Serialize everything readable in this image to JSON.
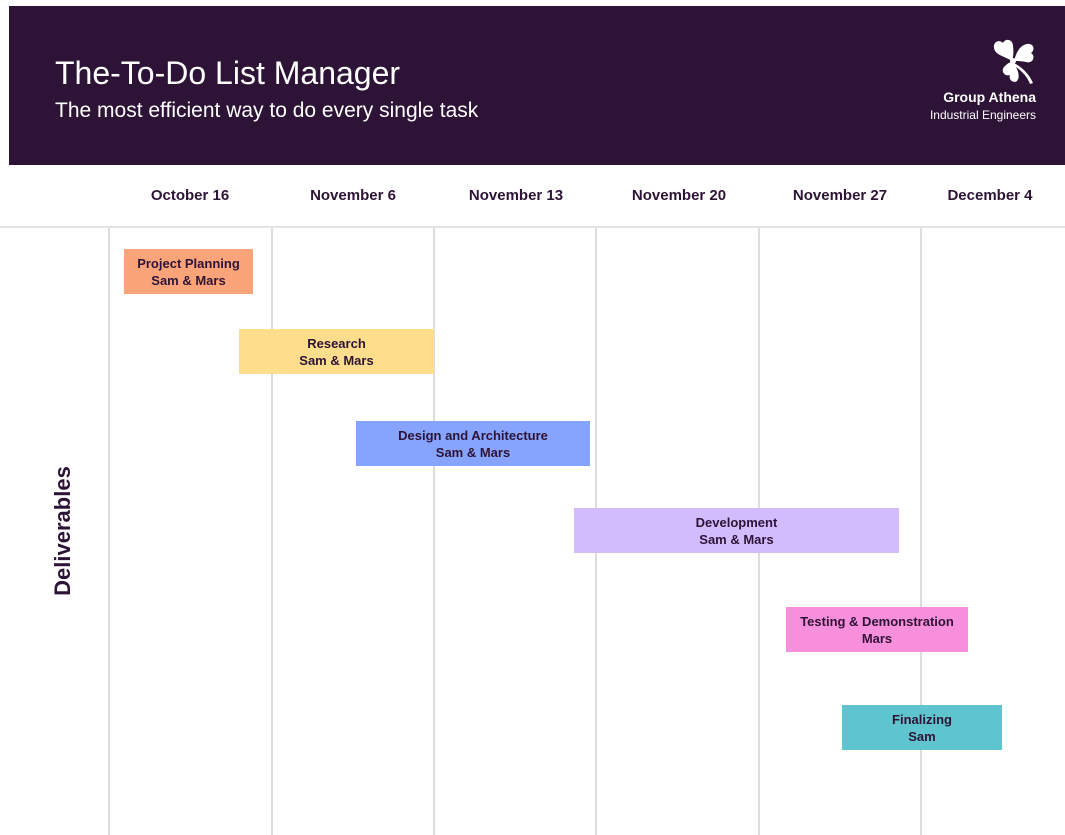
{
  "header": {
    "title": "The-To-Do List Manager",
    "subtitle": "The most efficient way to do every single task",
    "brand_name": "Group Athena",
    "brand_tagline": "Industrial Engineers",
    "logo_icon": "clover-icon"
  },
  "timeline": {
    "dates": [
      "October 16",
      "November 6",
      "November 13",
      "November 20",
      "November 27",
      "December 4"
    ],
    "row_label": "Deliverables"
  },
  "tasks": [
    {
      "name": "Project Planning",
      "owner": "Sam & Mars",
      "color": "#fba47a",
      "starts_before": "October 16",
      "ends_before": "November 6"
    },
    {
      "name": "Research",
      "owner": "Sam & Mars",
      "color": "#fedd8d",
      "starts_before": "November 6",
      "ends_at": "November 13"
    },
    {
      "name": "Design and Architecture",
      "owner": "Sam & Mars",
      "color": "#86a4fe",
      "starts_before": "November 13",
      "ends_before": "November 20"
    },
    {
      "name": "Development",
      "owner": "Sam & Mars",
      "color": "#d3bcfe",
      "starts_before": "November 20",
      "ends_before": "December 4"
    },
    {
      "name": "Testing & Demonstration",
      "owner": "Mars",
      "color": "#f88fdc",
      "starts_before": "November 27",
      "ends_after": "December 4"
    },
    {
      "name": "Finalizing",
      "owner": "Sam",
      "color": "#5ec4ce",
      "starts_before": "December 4",
      "ends_after": "December 4"
    }
  ],
  "colors": {
    "header_background": "#2d1436",
    "header_text": "#ffffff",
    "timeline_text": "#2d1436",
    "grid_line": "#dddddd"
  }
}
